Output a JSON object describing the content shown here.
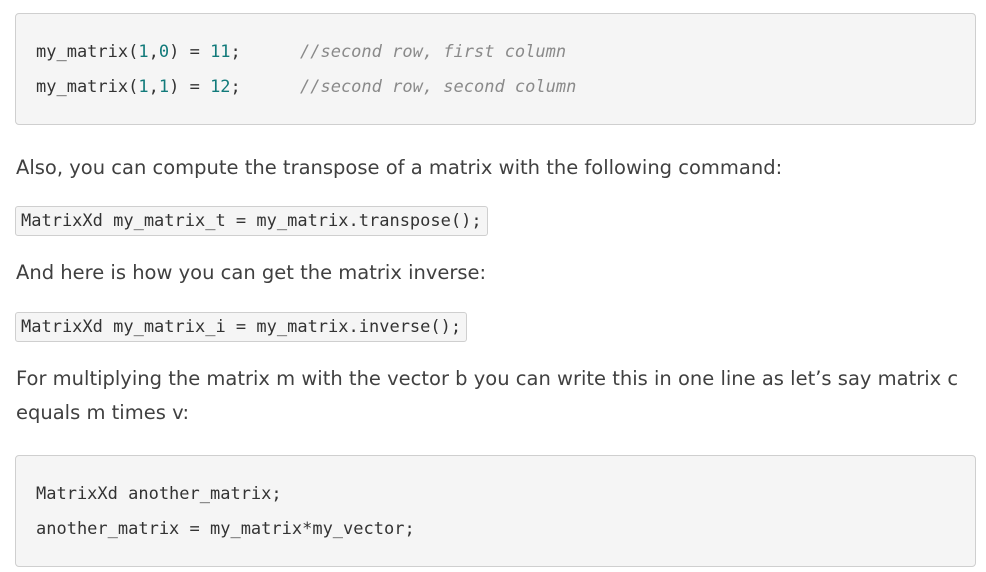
{
  "code_block_1": {
    "line_1": {
      "code_pre": "my_matrix(",
      "arg1": "1",
      "comma": ",",
      "arg2": "0",
      "code_post": ") = ",
      "value": "11",
      "semicolon": ";",
      "comment": "//second row, first column"
    },
    "line_2": {
      "code_pre": "my_matrix(",
      "arg1": "1",
      "comma": ",",
      "arg2": "1",
      "code_post": ") = ",
      "value": "12",
      "semicolon": ";",
      "comment": "//second row, second column"
    }
  },
  "paragraph_transpose": "Also, you can compute the transpose of a matrix with the following command:",
  "inline_code_transpose": "MatrixXd my_matrix_t = my_matrix.transpose();",
  "paragraph_inverse": "And here is how you can get the matrix inverse:",
  "inline_code_inverse": "MatrixXd my_matrix_i = my_matrix.inverse();",
  "paragraph_multiply": "For multiplying the matrix m with the vector b you can write this in one line as let’s say matrix c equals m times v:",
  "code_block_2": {
    "line_1": "MatrixXd another_matrix;",
    "line_2": "another_matrix = my_matrix*my_vector;"
  }
}
